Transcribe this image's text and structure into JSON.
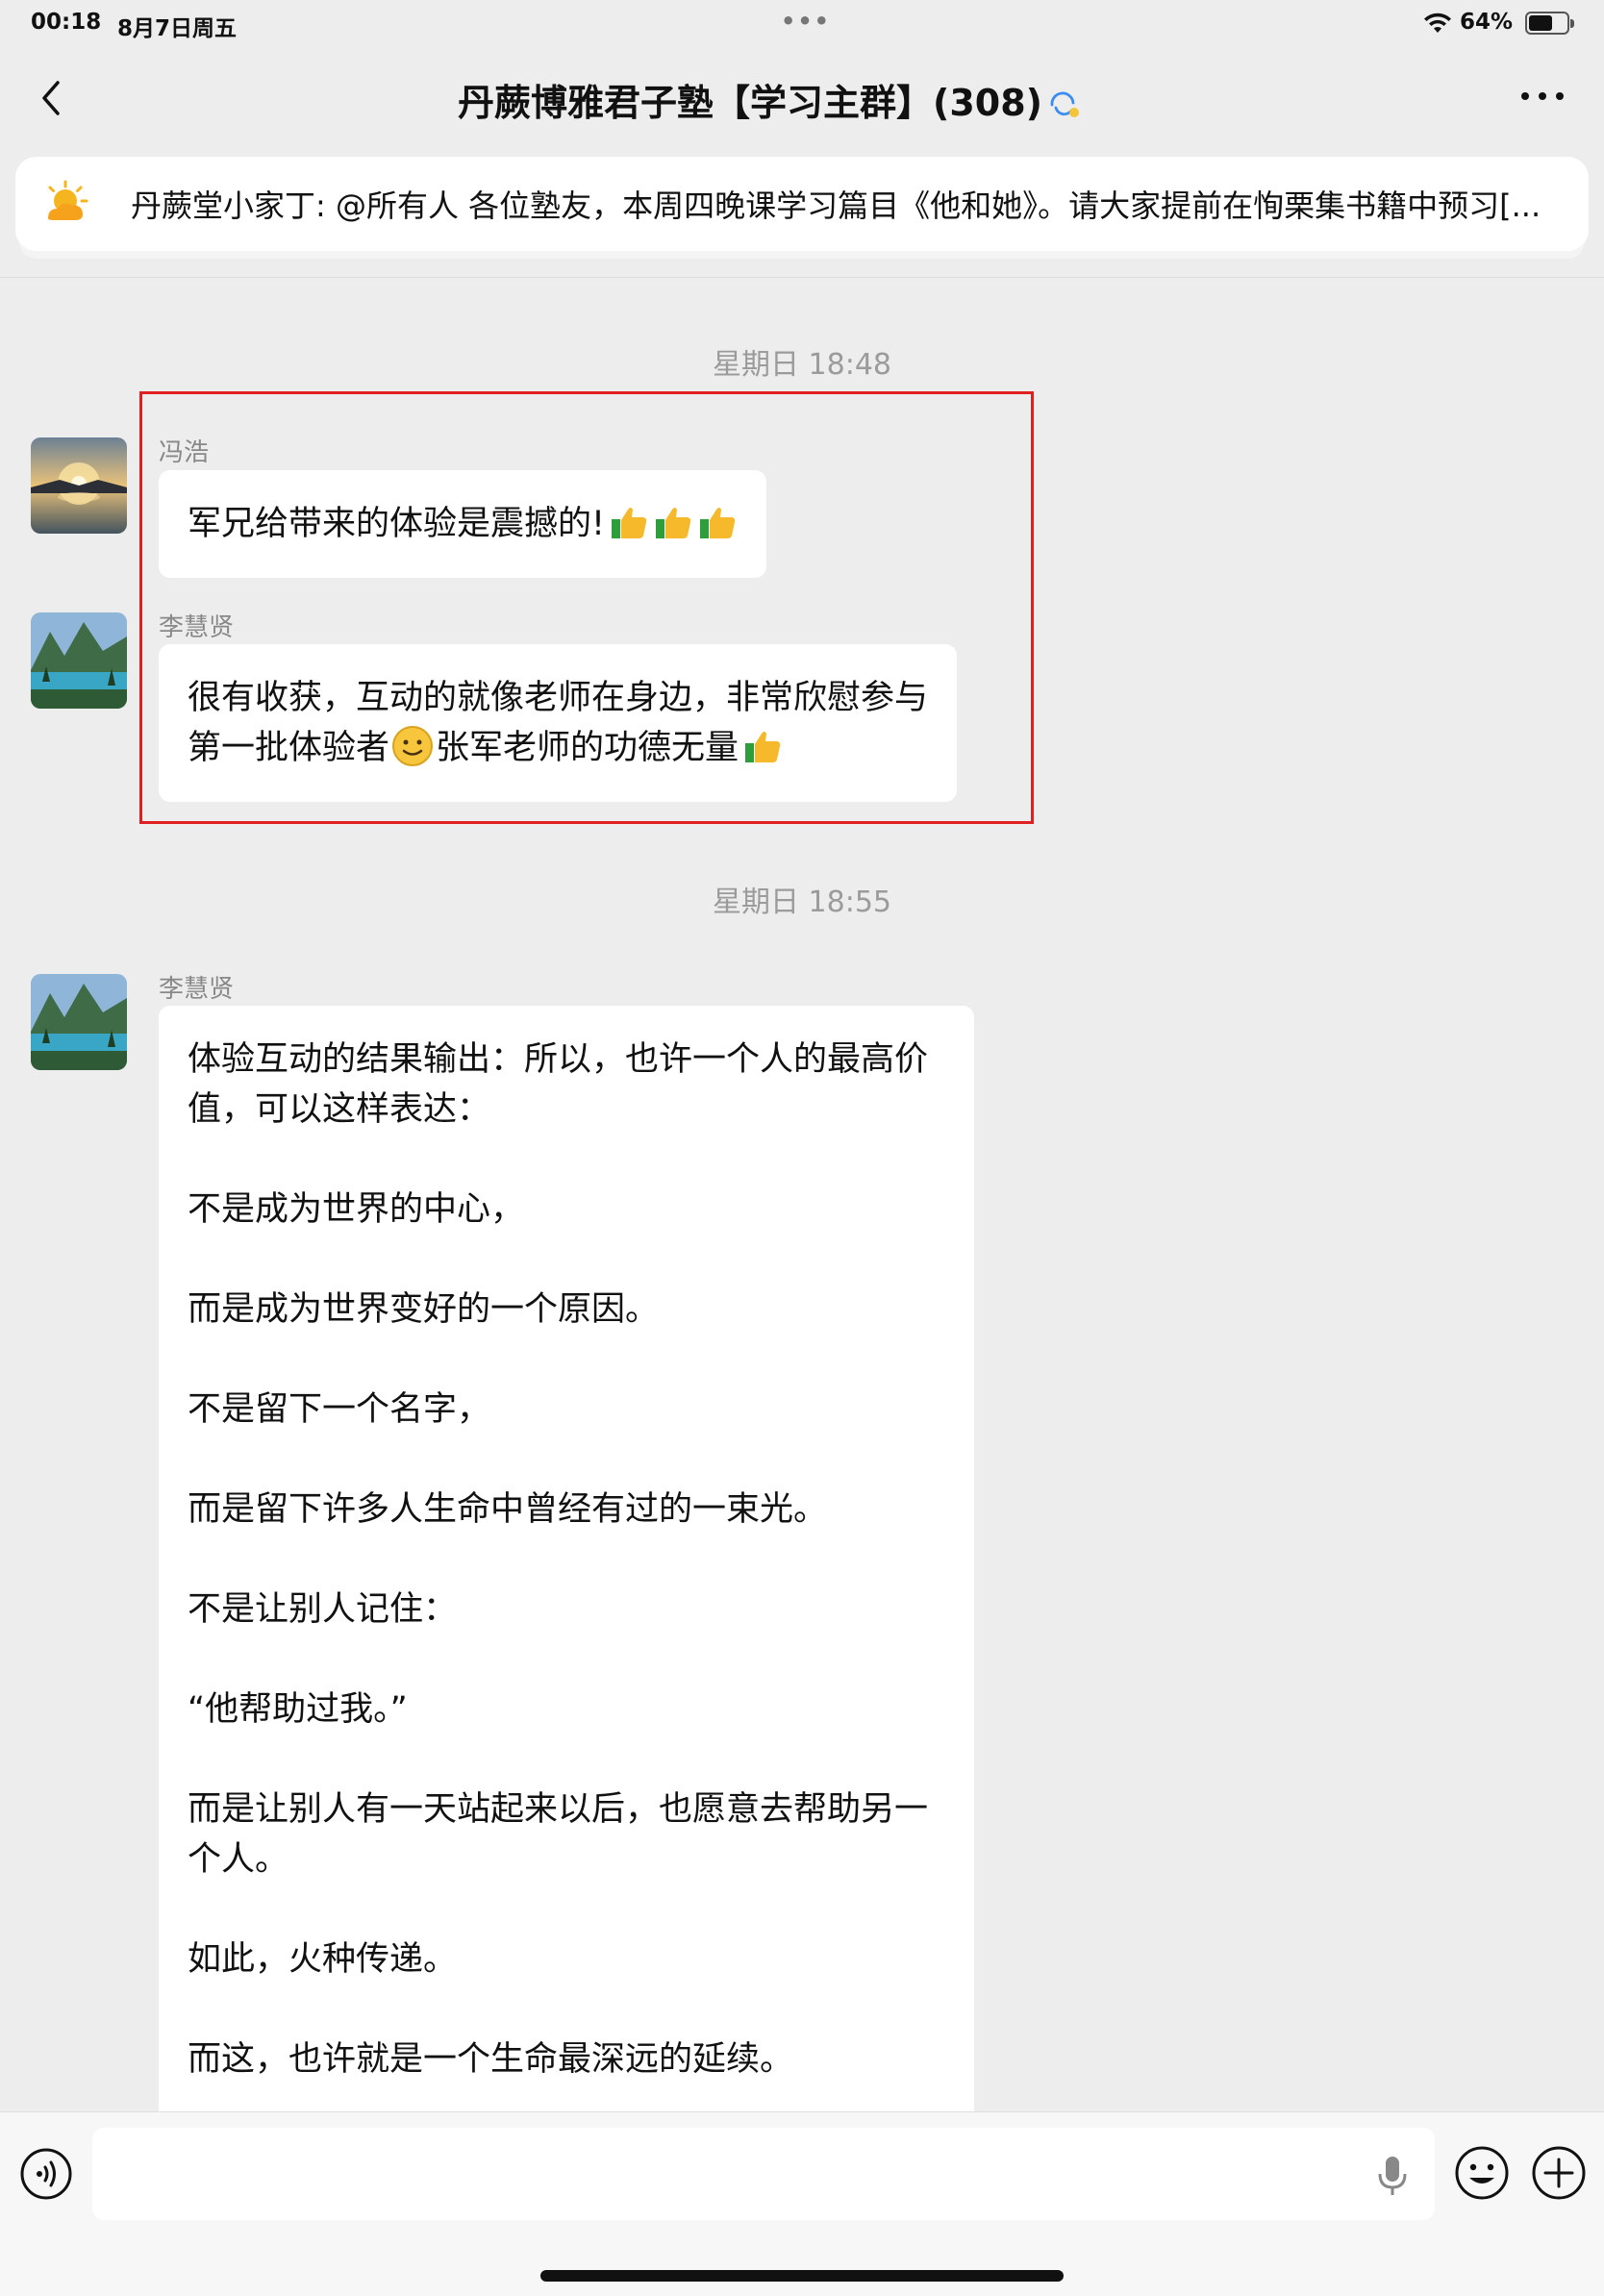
{
  "status_bar": {
    "time": "00:18",
    "date": "8月7日周五",
    "dots": "•••",
    "battery_percent": "64%",
    "battery_level": 0.64
  },
  "nav": {
    "title": "丹蕨博雅君子塾【学习主群】(308)",
    "icons": [
      "back-icon",
      "sync-icon",
      "more-icon"
    ]
  },
  "announcement": {
    "text": "丹蕨堂小家丁: @所有人 各位塾友，本周四晚课学习篇目《他和她》。请大家提前在恂栗集书籍中预习[..."
  },
  "timestamps": [
    "星期日 18:48",
    "星期日 18:55"
  ],
  "messages": [
    {
      "sender": "冯浩",
      "text": "军兄给带来的体验是震撼的!",
      "emojis": [
        "thumbs-up",
        "thumbs-up",
        "thumbs-up"
      ]
    },
    {
      "sender": "李慧贤",
      "text_a": "很有收获，互动的就像老师在身边，非常欣慰参与第一批体验者",
      "text_b": "张军老师的功德无量",
      "emojis": [
        "smile",
        "thumbs-up"
      ]
    },
    {
      "sender": "李慧贤",
      "lines": [
        "体验互动的结果输出：所以，也许一个人的最高价值，可以这样表达：",
        "不是成为世界的中心，",
        "而是成为世界变好的一个原因。",
        "不是留下一个名字，",
        "而是留下许多人生命中曾经有过的一束光。",
        "不是让别人记住：",
        "“他帮助过我。”",
        "而是让别人有一天站起来以后，也愿意去帮助另一个人。",
        "如此，火种传递。",
        "而这，也许就是一个生命最深远的延续。"
      ]
    }
  ],
  "input_bar": {
    "placeholder": "",
    "icons": [
      "voice-icon",
      "mic-icon",
      "emoji-icon",
      "add-icon"
    ]
  },
  "colors": {
    "background": "#ededed",
    "bubble": "#ffffff",
    "highlight": "#e02020",
    "timestamp": "#9b9b9b"
  }
}
